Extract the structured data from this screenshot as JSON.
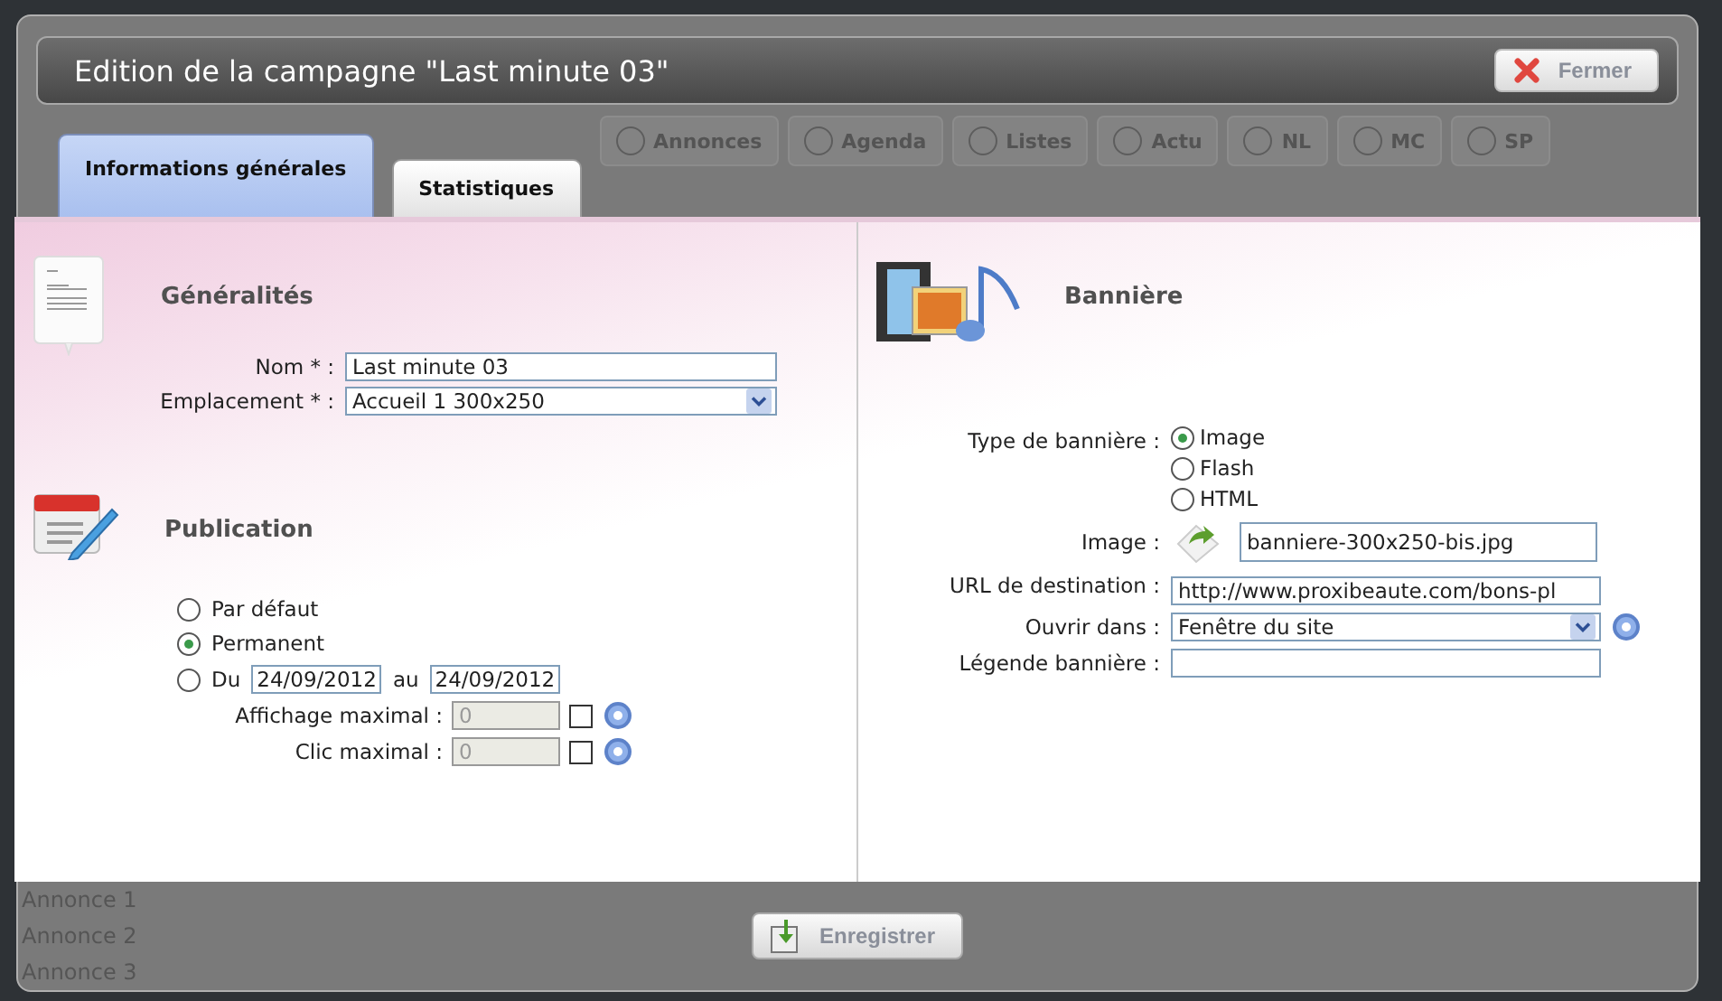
{
  "window": {
    "title": "Edition de la campagne \"Last minute 03\"",
    "close_button": "Fermer"
  },
  "tabs": [
    {
      "label": "Informations générales",
      "selected": true
    },
    {
      "label": "Statistiques",
      "selected": false
    }
  ],
  "background_tabs": [
    "Annonces",
    "Agenda",
    "Listes",
    "Actu",
    "NL",
    "MC",
    "SP"
  ],
  "generalites": {
    "title": "Généralités",
    "fields": [
      {
        "kind": "text",
        "label": "Nom * :",
        "value": "Last minute 03"
      },
      {
        "kind": "select",
        "label": "Emplacement * :",
        "value": "Accueil 1 300x250"
      }
    ]
  },
  "publication": {
    "title": "Publication",
    "options": [
      {
        "label": "Par défaut",
        "selected": false
      },
      {
        "label": "Permanent",
        "selected": true
      },
      {
        "label": "Du",
        "selected": false
      }
    ],
    "date_from": "24/09/2012",
    "date_separator": "au",
    "date_to": "24/09/2012",
    "limits": [
      {
        "label": "Affichage maximal :",
        "value": "0",
        "checked": false,
        "disabled": true
      },
      {
        "label": "Clic maximal :",
        "value": "0",
        "checked": false,
        "disabled": true
      }
    ]
  },
  "banniere": {
    "title": "Bannière",
    "type_label": "Type de bannière :",
    "types": [
      {
        "label": "Image",
        "selected": true
      },
      {
        "label": "Flash",
        "selected": false
      },
      {
        "label": "HTML",
        "selected": false
      }
    ],
    "fields": [
      {
        "kind": "file",
        "label": "Image :",
        "value": "banniere-300x250-bis.jpg"
      },
      {
        "kind": "text",
        "label": "URL de destination :",
        "value": "http://www.proxibeaute.com/bons-pl"
      },
      {
        "kind": "select",
        "label": "Ouvrir dans :",
        "value": "Fenêtre du site",
        "help": true
      },
      {
        "kind": "text",
        "label": "Légende bannière :"
      }
    ]
  },
  "footer": {
    "save_button": "Enregistrer",
    "background_rows": [
      "Annonce 1",
      "Annonce 2",
      "Annonce 3"
    ]
  }
}
